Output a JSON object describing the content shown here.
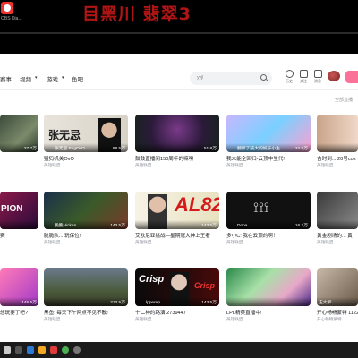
{
  "overlay": {
    "title": "目黑川 翡翠3",
    "app_label": "OBS Dia..."
  },
  "nav": {
    "items": [
      "赛事",
      "视频",
      "游戏",
      "鱼吧"
    ]
  },
  "search": {
    "placeholder": "yyjl"
  },
  "header_icons": [
    {
      "label": "历史"
    },
    {
      "label": "关注"
    },
    {
      "label": "消息"
    }
  ],
  "filter": {
    "label": "全部直播"
  },
  "cards": [
    {
      "title": "",
      "viewers": "27.7万",
      "streamer": "",
      "category": ""
    },
    {
      "title": "猛犸机关OvO",
      "viewers": "88.5万",
      "streamer": "张无忌 FugOvO",
      "category": "英雄联盟"
    },
    {
      "title": "鼓鼓直播间150周年的嘛嘿",
      "viewers": "51.8万",
      "streamer": "",
      "category": "英雄联盟"
    },
    {
      "title": "我未能全回归-云顶中生代!",
      "viewers": "22.5万",
      "streamer": "翻新了鼓大的娱乐小主",
      "category": "英雄联盟"
    },
    {
      "title": "吉时到... 20号cos",
      "viewers": "",
      "streamer": "",
      "category": "英雄联盟"
    },
    {
      "title": "赛",
      "viewers": "",
      "streamer": "",
      "category": ""
    },
    {
      "title": "脆脆队... 玩保位!",
      "viewers": "143.5万",
      "streamer": "脆脆Hicken",
      "category": "英雄联盟"
    },
    {
      "title": "艾欧尼亚挑战—星期冠大神上王者",
      "viewers": "143.5万",
      "streamer": "",
      "category": "英雄联盟"
    },
    {
      "title": "多小C: 我在云顶的啊！",
      "viewers": "16.7万",
      "streamer": "Dopa",
      "category": "英雄联盟"
    },
    {
      "title": "黄金剧场的... 黄",
      "viewers": "",
      "streamer": "",
      "category": "英雄联盟"
    },
    {
      "title": "想玩要了吧?",
      "viewers": "145.5万",
      "streamer": "",
      "category": ""
    },
    {
      "title": "黑鱼: 每天下午两点不见不散!",
      "viewers": "213.5万",
      "streamer": "",
      "category": "英雄联盟"
    },
    {
      "title": "十二神的路演 2739447",
      "viewers": "143.5万",
      "streamer": "lpperep",
      "category": "英雄联盟"
    },
    {
      "title": "LPL精英直播中!",
      "viewers": "",
      "streamer": "",
      "category": "英雄联盟"
    },
    {
      "title": "开心畅畅蒙特 11222",
      "viewers": "",
      "streamer": "王大爷",
      "category": "开心畅畅蒙特"
    }
  ],
  "colors": {
    "title_red": "#b01515",
    "accent_pink": "#fb7299"
  }
}
